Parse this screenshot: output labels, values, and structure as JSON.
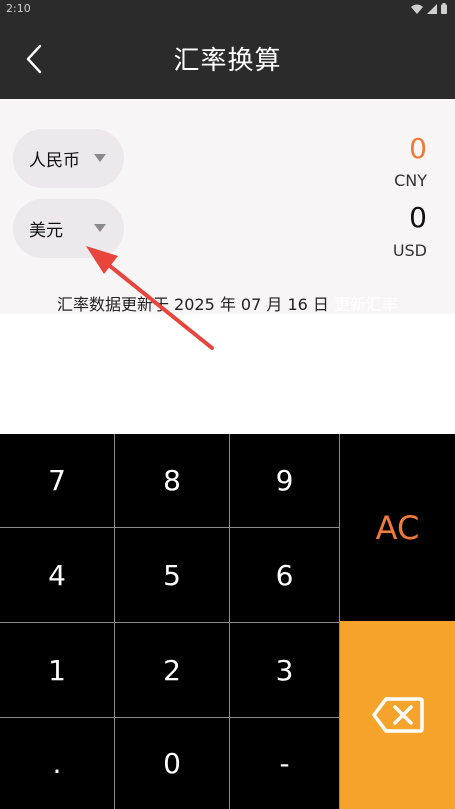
{
  "status_bar": {
    "time": "2:10"
  },
  "header": {
    "title": "汇率换算"
  },
  "converter": {
    "from": {
      "currency_name": "人民币",
      "amount": "0",
      "code": "CNY"
    },
    "to": {
      "currency_name": "美元",
      "amount": "0",
      "code": "USD"
    },
    "update_note": "汇率数据更新于 2025 年 07 月 16 日",
    "update_link": "更新汇率"
  },
  "keypad": {
    "keys": [
      "7",
      "8",
      "9",
      "4",
      "5",
      "6",
      "1",
      "2",
      "3",
      ".",
      "0",
      "-"
    ],
    "ac_label": "AC",
    "backspace_icon": "backspace-icon"
  },
  "colors": {
    "header_bg": "#2b2b2b",
    "accent_orange": "#f07a3a",
    "backspace_bg": "#f5a32b",
    "annotation_red": "#e8453c"
  }
}
